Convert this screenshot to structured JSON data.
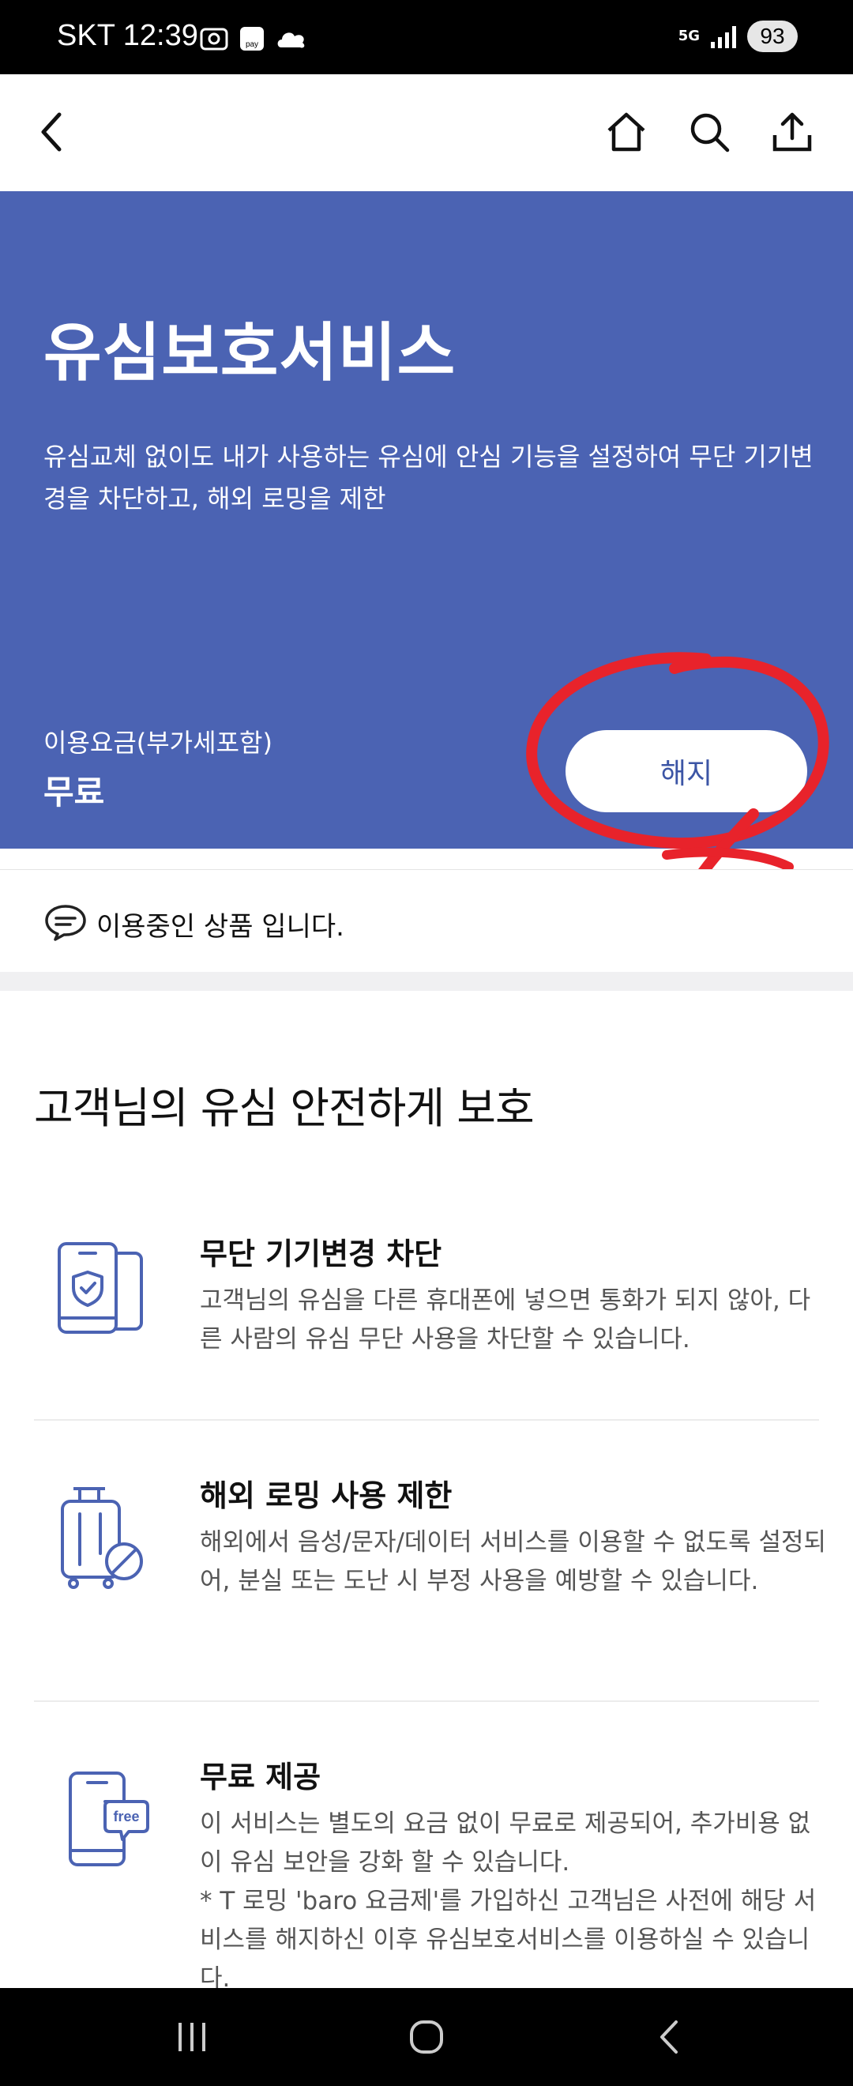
{
  "status_bar": {
    "carrier_time": "SKT 12:39",
    "network": "5G",
    "battery": "93",
    "pay_icon_text": "pay"
  },
  "header": {
    "back_icon": "chevron-left-icon",
    "home_icon": "home-icon",
    "search_icon": "search-icon",
    "share_icon": "share-icon"
  },
  "hero": {
    "title": "유심보호서비스",
    "description": "유심교체 없이도 내가 사용하는 유심에 안심 기능을 설정하여 무단 기기변경을 차단하고, 해외 로밍을 제한",
    "fee_label": "이용요금(부가세포함)",
    "fee_value": "무료",
    "cancel_button": "해지",
    "background_color": "#4b63b3"
  },
  "status_message": "이용중인 상품 입니다.",
  "section_title": "고객님의 유심 안전하게 보호",
  "features": [
    {
      "title": "무단 기기변경 차단",
      "description": "고객님의 유심을 다른 휴대폰에 넣으면 통화가 되지 않아, 다른 사람의 유심 무단 사용을 차단할 수 있습니다.",
      "icon": "phone-shield-icon"
    },
    {
      "title": "해외 로밍 사용 제한",
      "description": "해외에서 음성/문자/데이터 서비스를 이용할 수 없도록 설정되어, 분실 또는 도난 시 부정 사용을 예방할 수 있습니다.",
      "icon": "luggage-blocked-icon"
    },
    {
      "title": "무료 제공",
      "description": "이 서비스는 별도의 요금 없이 무료로 제공되어, 추가비용 없이 유심 보안을 강화 할 수 있습니다.\n* T 로밍 'baro 요금제'를 가입하신 고객님은 사전에 해당 서비스를 해지하신 이후 유심보호서비스를 이용하실 수 있습니다.",
      "icon": "phone-free-icon",
      "icon_label": "free"
    }
  ],
  "nav_bar": {
    "recents_icon": "recent-apps-icon",
    "home_icon": "home-circle-icon",
    "back_icon": "back-icon"
  }
}
